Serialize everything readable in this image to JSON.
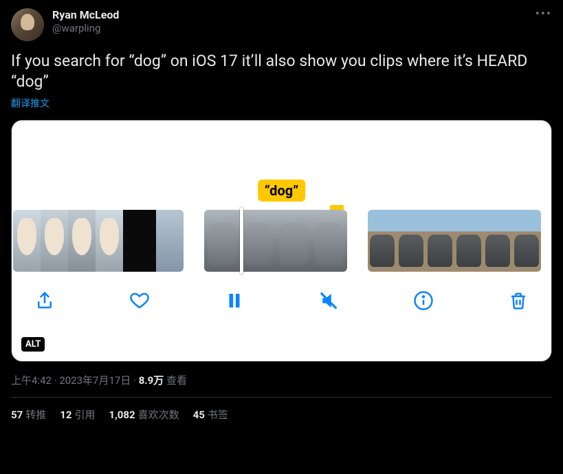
{
  "author": {
    "display_name": "Ryan McLeod",
    "handle": "@warpling"
  },
  "tweet_text": "If you search for “dog” on iOS 17 it’ll also show you clips where it’s HEARD “dog”",
  "translate_label": "翻译推文",
  "media": {
    "keyword_label": "“dog”",
    "alt_badge": "ALT"
  },
  "meta": {
    "time": "上午4:42",
    "date": "2023年7月17日",
    "views_count": "8.9万",
    "views_label": "查看",
    "separator": " · "
  },
  "stats": {
    "retweets": {
      "count": "57",
      "label": "转推"
    },
    "quotes": {
      "count": "12",
      "label": "引用"
    },
    "likes": {
      "count": "1,082",
      "label": "喜欢次数"
    },
    "bookmarks": {
      "count": "45",
      "label": "书签"
    }
  }
}
